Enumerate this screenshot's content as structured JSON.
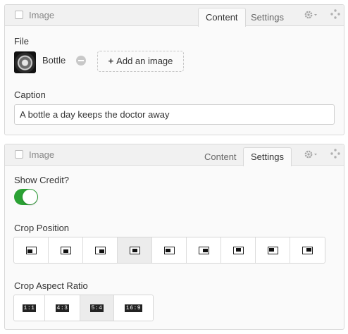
{
  "panel1": {
    "title": "Image",
    "tabs": [
      {
        "label": "Content",
        "active": true
      },
      {
        "label": "Settings",
        "active": false
      }
    ],
    "file_label": "File",
    "file_name": "Bottle",
    "add_image_label": "Add an image",
    "caption_label": "Caption",
    "caption_value": "A bottle a day keeps the doctor away"
  },
  "panel2": {
    "title": "Image",
    "tabs": [
      {
        "label": "Content",
        "active": false
      },
      {
        "label": "Settings",
        "active": true
      }
    ],
    "show_credit_label": "Show Credit?",
    "show_credit_on": true,
    "crop_position_label": "Crop Position",
    "crop_positions": [
      {
        "name": "bottom-left",
        "selected": false
      },
      {
        "name": "bottom-center",
        "selected": false
      },
      {
        "name": "bottom-right",
        "selected": false
      },
      {
        "name": "center",
        "selected": true
      },
      {
        "name": "center-left",
        "selected": false
      },
      {
        "name": "center-right",
        "selected": false
      },
      {
        "name": "top-center",
        "selected": false
      },
      {
        "name": "top-left",
        "selected": false
      },
      {
        "name": "top-right",
        "selected": false
      }
    ],
    "crop_ratio_label": "Crop Aspect Ratio",
    "crop_ratios": [
      {
        "label": "1:1",
        "selected": false
      },
      {
        "label": "4:3",
        "selected": false
      },
      {
        "label": "5:4",
        "selected": true
      },
      {
        "label": "16:9",
        "selected": false
      }
    ]
  },
  "colors": {
    "toggle_on": "#2ba134",
    "selected_button": "#ececec",
    "panel_header": "#f1f1f1"
  },
  "icons": [
    "checkbox-icon",
    "gear-icon",
    "move-icon",
    "remove-icon",
    "plus-icon"
  ]
}
